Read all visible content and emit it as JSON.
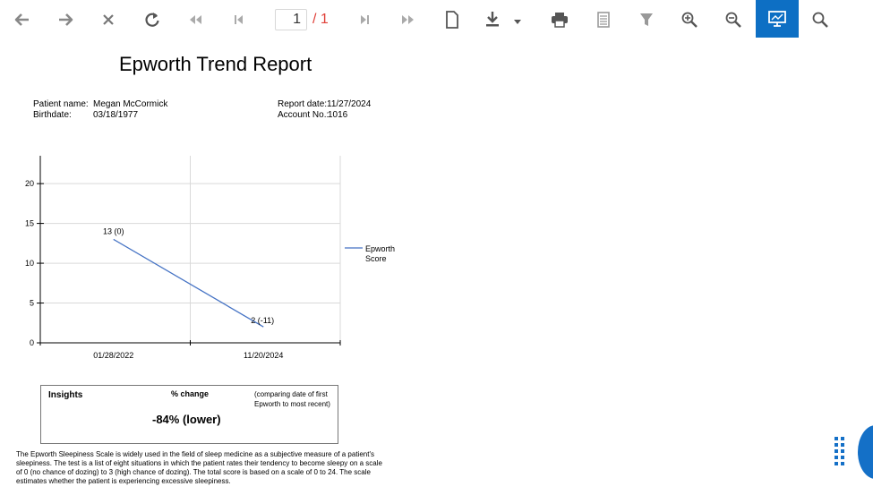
{
  "toolbar": {
    "items": [
      {
        "name": "back-icon",
        "label": "Back"
      },
      {
        "name": "forward-icon",
        "label": "Forward"
      },
      {
        "name": "close-icon",
        "label": "Close"
      },
      {
        "name": "refresh-icon",
        "label": "Refresh"
      },
      {
        "name": "previous-icon",
        "label": "Previous page"
      },
      {
        "name": "first-page-icon",
        "label": "First page"
      },
      {
        "name": "last-page-icon",
        "label": "Last page"
      },
      {
        "name": "next-icon",
        "label": "Next page"
      },
      {
        "name": "page-icon",
        "label": "Page"
      },
      {
        "name": "download-icon",
        "label": "Download"
      },
      {
        "name": "print-icon",
        "label": "Print"
      },
      {
        "name": "document-icon",
        "label": "Document"
      },
      {
        "name": "filter-icon",
        "label": "Filter"
      },
      {
        "name": "zoom-in-icon",
        "label": "Zoom in"
      },
      {
        "name": "zoom-out-icon",
        "label": "Zoom out"
      },
      {
        "name": "present-icon",
        "label": "Presentation"
      },
      {
        "name": "search-icon",
        "label": "Search"
      }
    ],
    "page_current": "1",
    "page_total": "/ 1",
    "accent_color": "#0d6fc4",
    "page_total_color": "#e0413a"
  },
  "report": {
    "title": "Epworth Trend Report",
    "patient_name_label": "Patient name:",
    "patient_name": "Megan McCormick",
    "birthdate_label": "Birthdate:",
    "birthdate": "03/18/1977",
    "report_date_label": "Report date:",
    "report_date": "11/27/2024",
    "account_label": "Account No.:",
    "account": "1016"
  },
  "chart_data": {
    "type": "line",
    "categories": [
      "01/28/2022",
      "11/20/2024"
    ],
    "series": [
      {
        "name": "Epworth Score",
        "values": [
          13,
          2
        ],
        "labels": [
          "13 (0)",
          "2 (-11)"
        ],
        "color": "#4472c4"
      }
    ],
    "ylim": [
      0,
      24
    ],
    "yticks": [
      0,
      5,
      10,
      15,
      20
    ],
    "grid": true,
    "legend": "right",
    "title": "",
    "xlabel": "",
    "ylabel": ""
  },
  "insights": {
    "title": "Insights",
    "change_label": "% change",
    "note": "(comparing date of first Epworth to most recent)",
    "value": "-84% (lower)"
  },
  "description": "The Epworth Sleepiness Scale is widely used in the field of sleep medicine as a subjective measure of a patient's sleepiness.  The test is a list of eight situations in which the patient rates their tendency to become sleepy on a scale of 0 (no chance of dozing) to 3 (high chance of dozing).  The total score is based on a scale of 0 to 24.  The scale estimates whether the patient is experiencing excessive sleepiness."
}
